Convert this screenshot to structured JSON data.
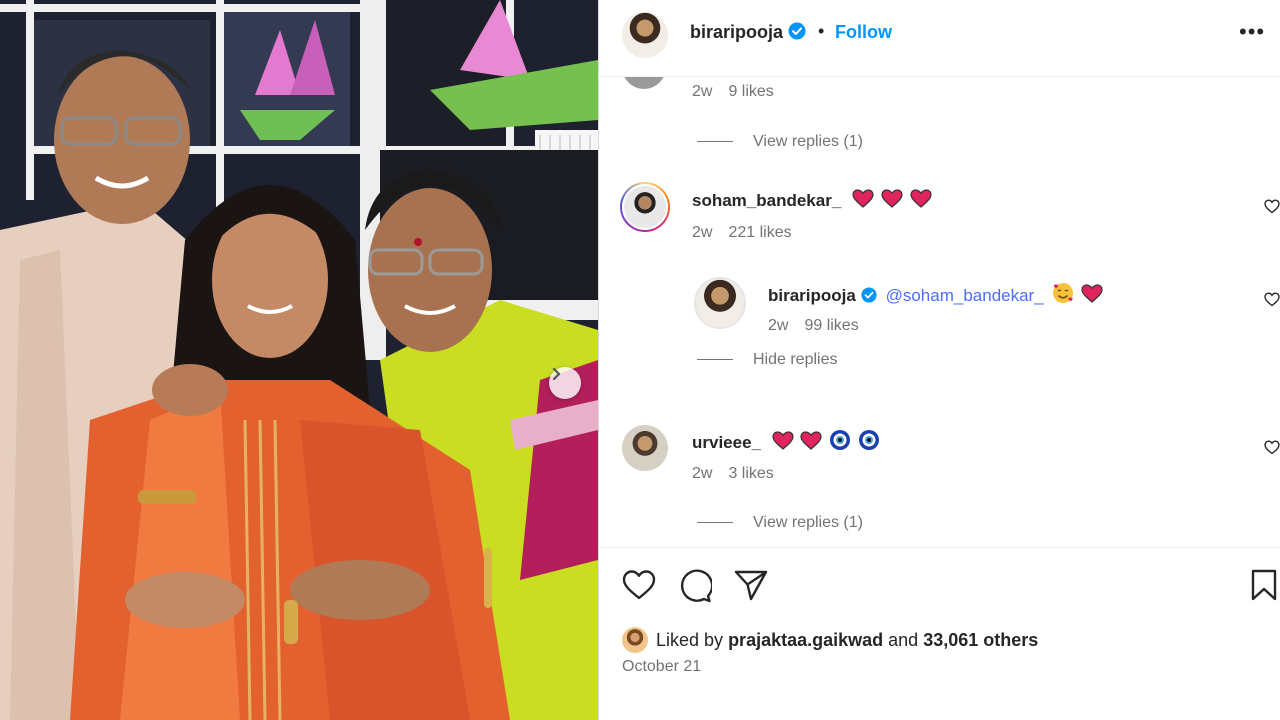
{
  "post": {
    "author": "biraripooja",
    "follow_label": "Follow",
    "separator": "•",
    "more_label": "•••"
  },
  "comments": {
    "first_meta": {
      "time": "2w",
      "likes": "9 likes"
    },
    "first_view_replies": "View replies (1)",
    "soham": {
      "username": "soham_bandekar_",
      "time": "2w",
      "likes": "221 likes",
      "reply": {
        "username": "biraripooja",
        "mention": "@soham_bandekar_",
        "time": "2w",
        "likes": "99 likes"
      },
      "hide_replies": "Hide replies"
    },
    "urvieee": {
      "username": "urvieee_",
      "time": "2w",
      "likes": "3 likes",
      "view_replies": "View replies (1)"
    }
  },
  "footer": {
    "liked_by_prefix": "Liked by",
    "liked_by_user": "prajaktaa.gaikwad",
    "liked_by_and": "and",
    "liked_by_count": "33,061 others",
    "date": "October 21"
  },
  "icons": {
    "like": "heart-icon",
    "comment": "comment-icon",
    "share": "send-icon",
    "save": "bookmark-icon",
    "carousel": "chevron-right-icon",
    "verified": "verified-badge-icon",
    "more": "more-icon"
  },
  "colors": {
    "link_blue": "#0095f6",
    "muted": "#737373",
    "text": "#262626",
    "verified_blue": "#0095f6",
    "emoji_heart": "#e0245e"
  }
}
